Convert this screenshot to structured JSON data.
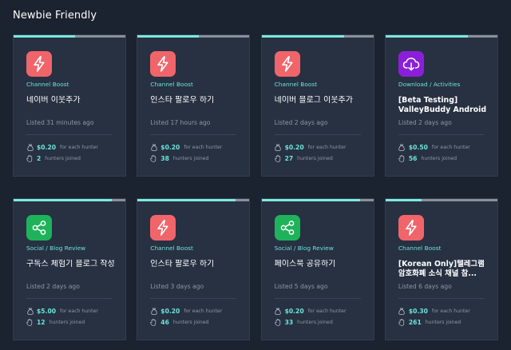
{
  "section": {
    "title": "Newbie Friendly"
  },
  "colors": {
    "background": "#1b2230",
    "card": "#273142",
    "accent": "#6fe3db",
    "channel_boost_icon": "#f0656a",
    "download_icon": "#8b1fd9",
    "social_icon": "#1eb35a"
  },
  "labels": {
    "price_suffix": "for each hunter",
    "hunters_suffix": "hunters joined"
  },
  "cards": [
    {
      "icon": "lightning-icon",
      "category": "Channel Boost",
      "title": "네이버 이웃추가",
      "listed": "Listed 31 minutes ago",
      "price": "$0.20",
      "hunters": "2",
      "progress": 0.55
    },
    {
      "icon": "lightning-icon",
      "category": "Channel Boost",
      "title": "인스타 팔로우 하기",
      "listed": "Listed 17 hours ago",
      "price": "$0.20",
      "hunters": "38",
      "progress": 0.55
    },
    {
      "icon": "lightning-icon",
      "category": "Channel Boost",
      "title": "네이버 블로그 이웃추가",
      "listed": "Listed 2 days ago",
      "price": "$0.20",
      "hunters": "27",
      "progress": 0.74
    },
    {
      "icon": "cloud-download-icon",
      "category": "Download / Activities",
      "title": "[Beta Testing] ValleyBuddy Android",
      "listed": "Listed 2 days ago",
      "price": "$0.50",
      "hunters": "56",
      "progress": 0.74
    },
    {
      "icon": "share-icon",
      "category": "Social / Blog Review",
      "title": "구독스 체험기 블로그 작성",
      "listed": "Listed 2 days ago",
      "price": "$5.00",
      "hunters": "12",
      "progress": 0.88
    },
    {
      "icon": "lightning-icon",
      "category": "Channel Boost",
      "title": "인스타 팔로우 하기",
      "listed": "Listed 3 days ago",
      "price": "$0.20",
      "hunters": "46",
      "progress": 0.88
    },
    {
      "icon": "share-icon",
      "category": "Social / Blog Review",
      "title": "페이스북 공유하기",
      "listed": "Listed 5 days ago",
      "price": "$0.20",
      "hunters": "33",
      "progress": 0.88
    },
    {
      "icon": "lightning-icon",
      "category": "Channel Boost",
      "title": "[Korean Only]텔레그램 암호화폐 소식 채널 참...",
      "listed": "Listed 6 days ago",
      "price": "$0.30",
      "hunters": "261",
      "progress": 0.32
    }
  ]
}
